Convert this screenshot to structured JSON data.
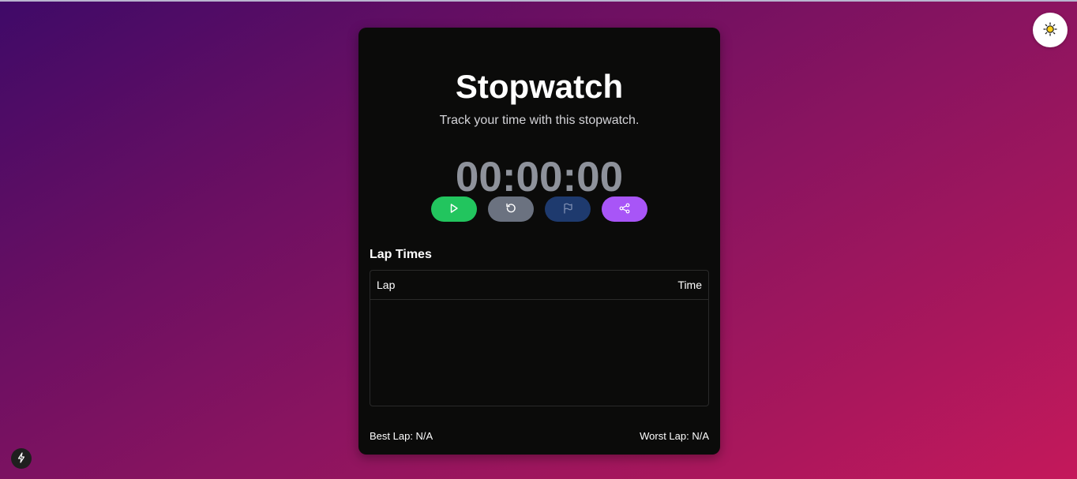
{
  "app": {
    "title": "Stopwatch",
    "subtitle": "Track your time with this stopwatch.",
    "timer_display": "00:00:00"
  },
  "controls": {
    "start_icon": "play-icon",
    "reset_icon": "rotate-ccw-icon",
    "lap_icon": "flag-icon",
    "share_icon": "share-icon",
    "colors": {
      "start": "#22c55e",
      "reset": "#6b7280",
      "lap": "#1e3a6e",
      "share": "#a855f7"
    }
  },
  "laps": {
    "heading": "Lap Times",
    "columns": [
      "Lap",
      "Time"
    ],
    "rows": []
  },
  "stats": {
    "best_lap": "Best Lap: N/A",
    "worst_lap": "Worst Lap: N/A"
  },
  "theme_toggle": {
    "icon": "sun-icon"
  },
  "dev_badge": {
    "icon": "lightning-icon"
  }
}
